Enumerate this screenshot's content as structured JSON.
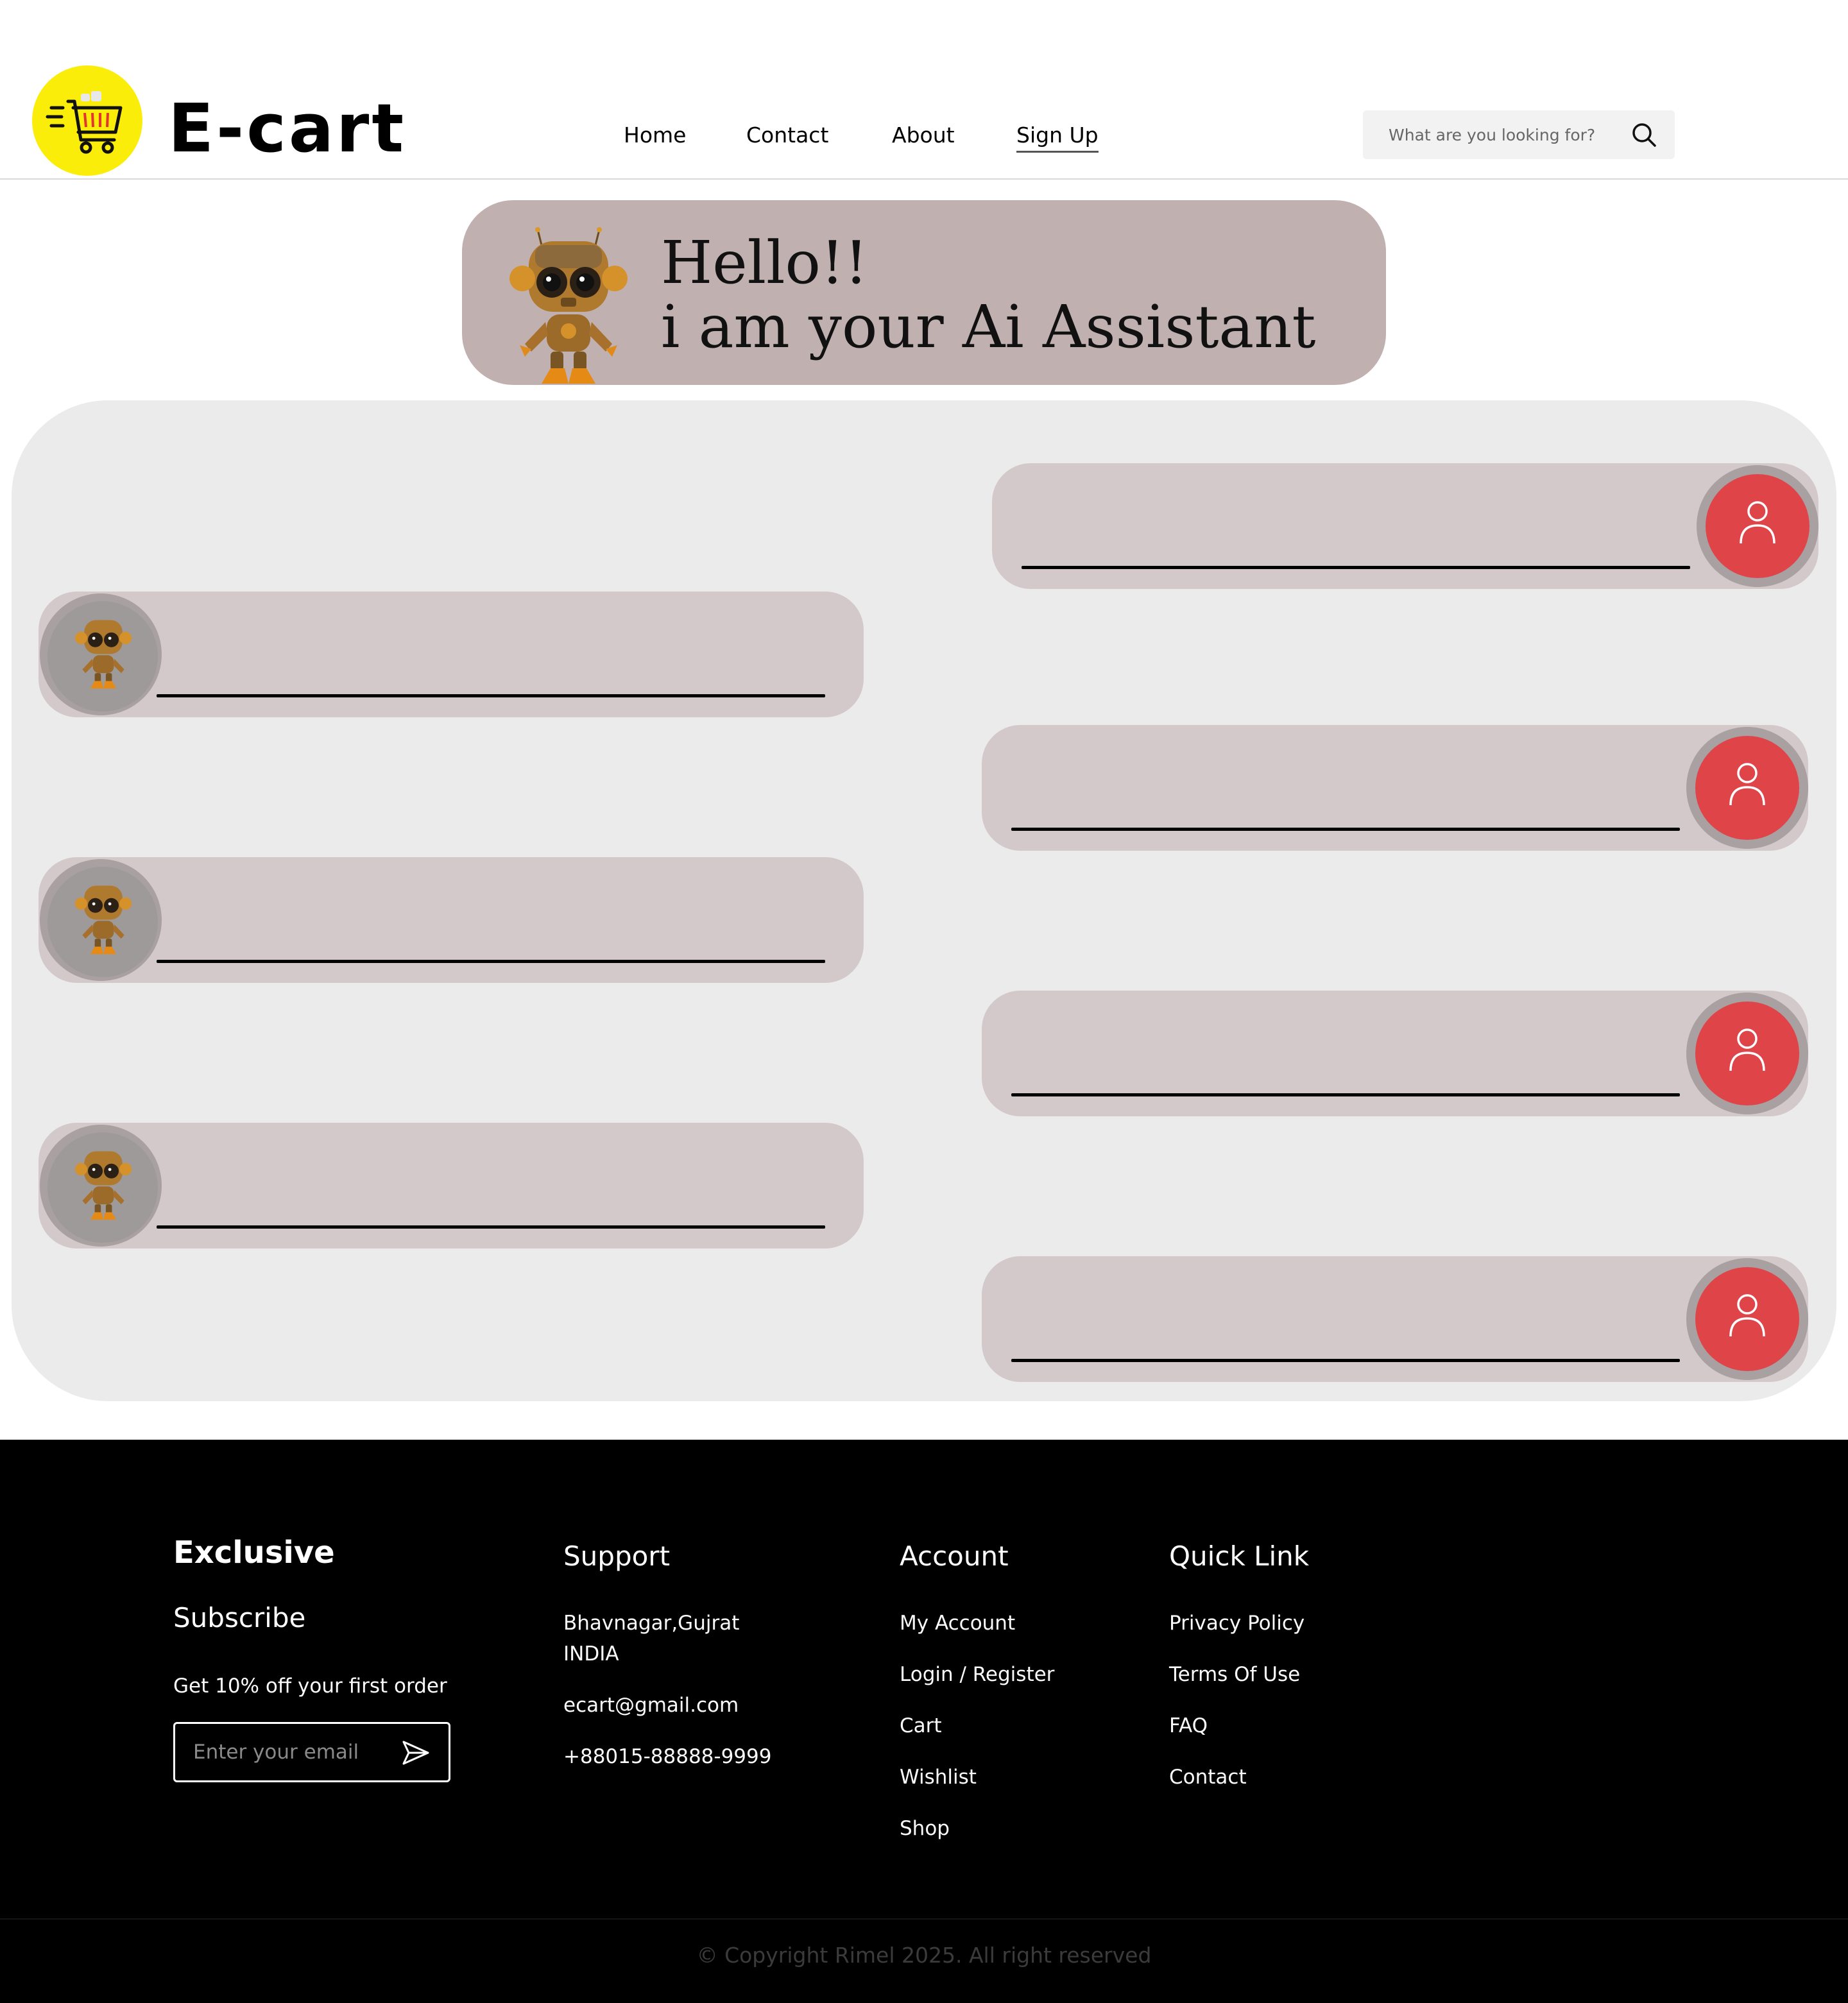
{
  "brand": {
    "name": "E-cart",
    "logo_color": "#fbed0a"
  },
  "nav": {
    "home": "Home",
    "contact": "Contact",
    "about": "About",
    "signup": "Sign Up"
  },
  "search": {
    "placeholder": "What are you looking for?",
    "icon": "search-icon"
  },
  "banner": {
    "line1": "Hello!!",
    "line2": "i am your Ai Assistant",
    "background": "#c1b0b0"
  },
  "chat": {
    "panel_color": "#ebebeb",
    "bubble_color": "#d4c9ca",
    "user_avatar_color": "#df4449",
    "user_messages": [
      "",
      "",
      "",
      ""
    ],
    "bot_messages": [
      "",
      "",
      ""
    ]
  },
  "footer": {
    "exclusive": {
      "title": "Exclusive",
      "subtitle": "Subscribe",
      "offer": "Get 10% off your first order",
      "email_placeholder": "Enter your email"
    },
    "support": {
      "title": "Support",
      "address_line1": "Bhavnagar,Gujrat",
      "address_line2": "INDIA",
      "email": "ecart@gmail.com",
      "phone": "+88015-88888-9999"
    },
    "account": {
      "title": "Account",
      "items": [
        "My Account",
        "Login / Register",
        "Cart",
        "Wishlist",
        "Shop"
      ]
    },
    "quick_link": {
      "title": "Quick Link",
      "items": [
        "Privacy Policy",
        "Terms Of Use",
        "FAQ",
        "Contact"
      ]
    },
    "copyright": "Copyright Rimel 2025. All right reserved"
  }
}
